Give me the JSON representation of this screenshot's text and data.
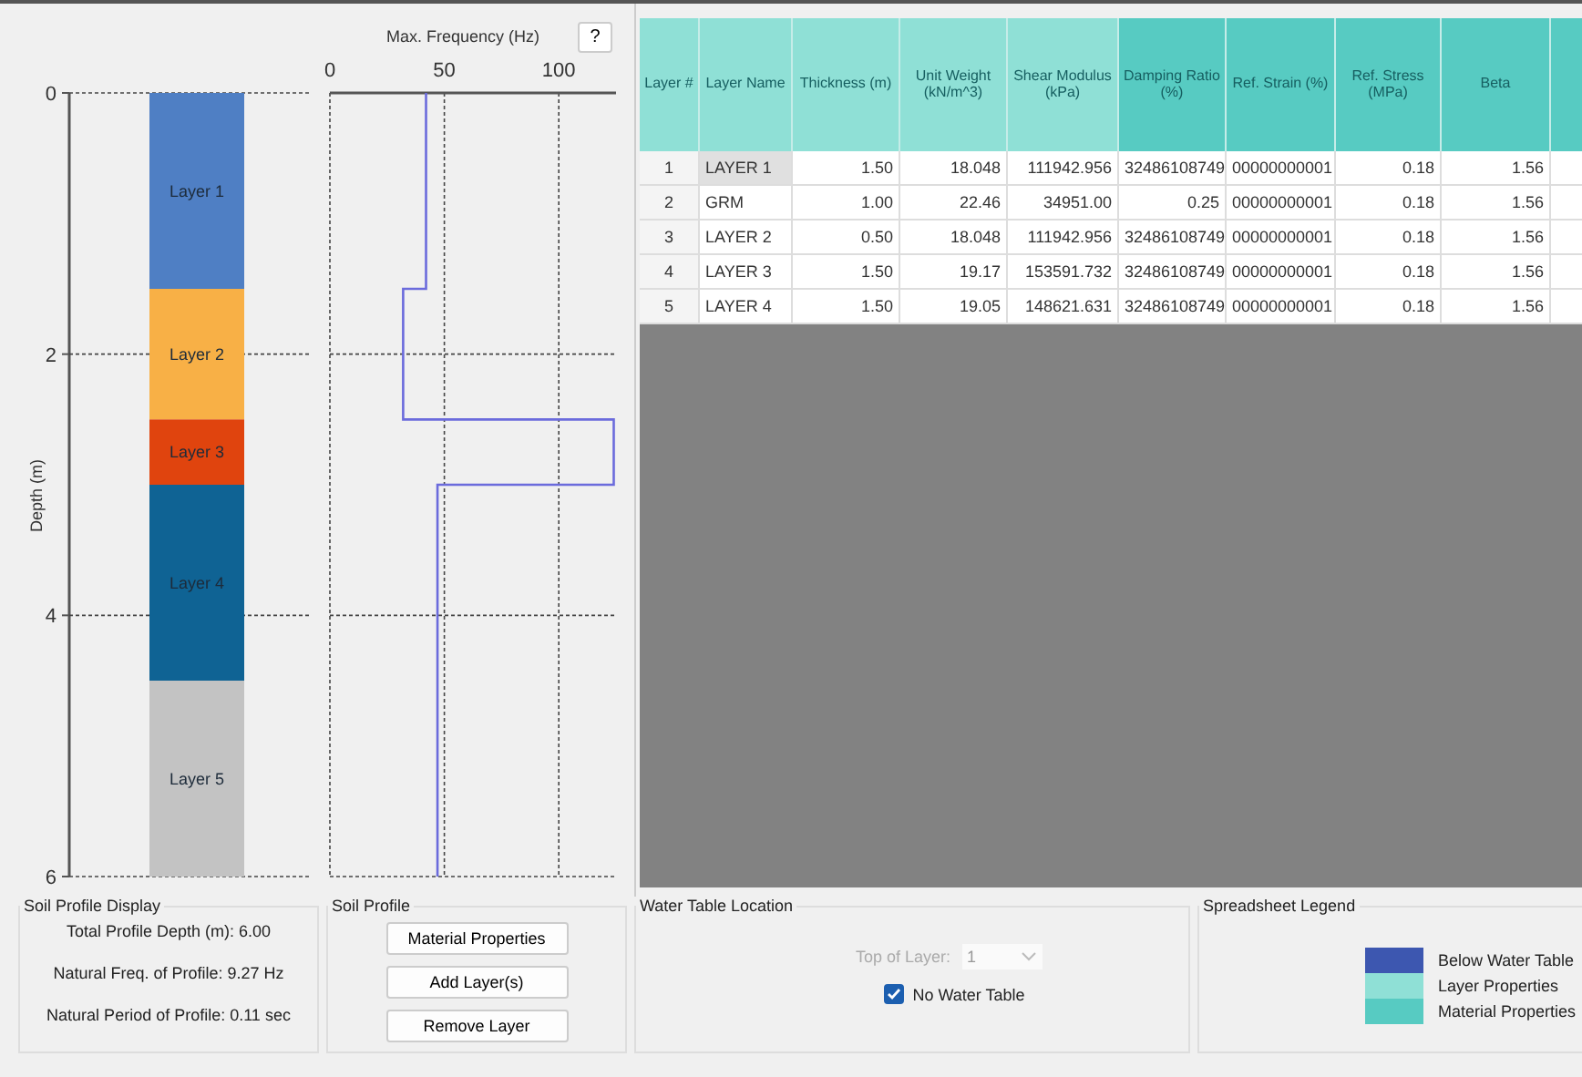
{
  "soil_column": {
    "chart_data": {
      "type": "bar",
      "stacked": true,
      "grid": true,
      "ylabel": "Depth (m)",
      "ylim": [
        6,
        0
      ],
      "yticks": [
        0,
        2,
        4,
        6
      ],
      "series": [
        {
          "name": "Layer 1",
          "color": "#4f7fc4",
          "values": [
            1.5
          ]
        },
        {
          "name": "Layer 2",
          "color": "#f8b046",
          "values": [
            1.0
          ]
        },
        {
          "name": "Layer 3",
          "color": "#e0440e",
          "values": [
            0.5
          ]
        },
        {
          "name": "Layer 4",
          "color": "#0f6394",
          "values": [
            1.5
          ]
        },
        {
          "name": "Layer 5",
          "color": "#c3c3c3",
          "values": [
            1.5
          ]
        }
      ]
    }
  },
  "frequency_profile": {
    "help_button": "?",
    "chart_data": {
      "type": "line",
      "grid": true,
      "title": "Max. Frequency (Hz)",
      "x": [
        42,
        42,
        32,
        32,
        124,
        124,
        47,
        47
      ],
      "xlim": [
        0,
        125
      ],
      "ylim": [
        6,
        0
      ],
      "xticks": [
        0,
        50,
        100
      ],
      "series": [
        {
          "color": "#6b6bdc",
          "values": [
            0,
            1.5,
            1.5,
            2.5,
            2.5,
            3,
            3,
            6
          ]
        }
      ]
    }
  },
  "table": {
    "columns": [
      {
        "label": "Layer #",
        "kind": "layer"
      },
      {
        "label": "Layer Name",
        "kind": "layer"
      },
      {
        "label": "Thickness (m)",
        "kind": "layer"
      },
      {
        "label": "Unit Weight (kN/m^3)",
        "kind": "layer"
      },
      {
        "label": "Shear Modulus (kPa)",
        "kind": "layer"
      },
      {
        "label": "Damping Ratio (%)",
        "kind": "material"
      },
      {
        "label": "Ref. Strain (%)",
        "kind": "material"
      },
      {
        "label": "Ref. Stress (MPa)",
        "kind": "material"
      },
      {
        "label": "Beta",
        "kind": "material"
      }
    ],
    "rows": [
      {
        "cells": [
          "1",
          "LAYER 1",
          "1.50",
          "18.048",
          "111942.956",
          "32486108749",
          "00000000001",
          "0.18",
          "1.56"
        ],
        "selected": true
      },
      {
        "cells": [
          "2",
          "GRM",
          "1.00",
          "22.46",
          "34951.00",
          "0.25",
          "00000000001",
          "0.18",
          "1.56"
        ],
        "selected": false
      },
      {
        "cells": [
          "3",
          "LAYER 2",
          "0.50",
          "18.048",
          "111942.956",
          "32486108749",
          "00000000001",
          "0.18",
          "1.56"
        ],
        "selected": false
      },
      {
        "cells": [
          "4",
          "LAYER 3",
          "1.50",
          "19.17",
          "153591.732",
          "32486108749",
          "00000000001",
          "0.18",
          "1.56"
        ],
        "selected": false
      },
      {
        "cells": [
          "5",
          "LAYER 4",
          "1.50",
          "19.05",
          "148621.631",
          "32486108749",
          "00000000001",
          "0.18",
          "1.56"
        ],
        "selected": false
      }
    ]
  },
  "soil_profile_display": {
    "title": "Soil Profile Display",
    "lines": [
      "Total Profile Depth (m): 6.00",
      "Natural Freq. of Profile: 9.27 Hz",
      "Natural Period of Profile: 0.11 sec"
    ]
  },
  "soil_profile": {
    "title": "Soil Profile",
    "buttons": [
      "Material Properties",
      "Add Layer(s)",
      "Remove Layer"
    ]
  },
  "water_table": {
    "title": "Water Table Location",
    "top_of_layer_label": "Top of Layer:",
    "top_of_layer_value": "1",
    "disabled": true,
    "no_water_table": {
      "label": "No Water Table",
      "checked": true
    }
  },
  "legend": {
    "title": "Spreadsheet Legend",
    "items": [
      {
        "label": "Below Water Table",
        "color": "#3d57b0"
      },
      {
        "label": "Layer Properties",
        "color": "#8fe0d6"
      },
      {
        "label": "Material Properties",
        "color": "#57cbc2"
      }
    ]
  }
}
